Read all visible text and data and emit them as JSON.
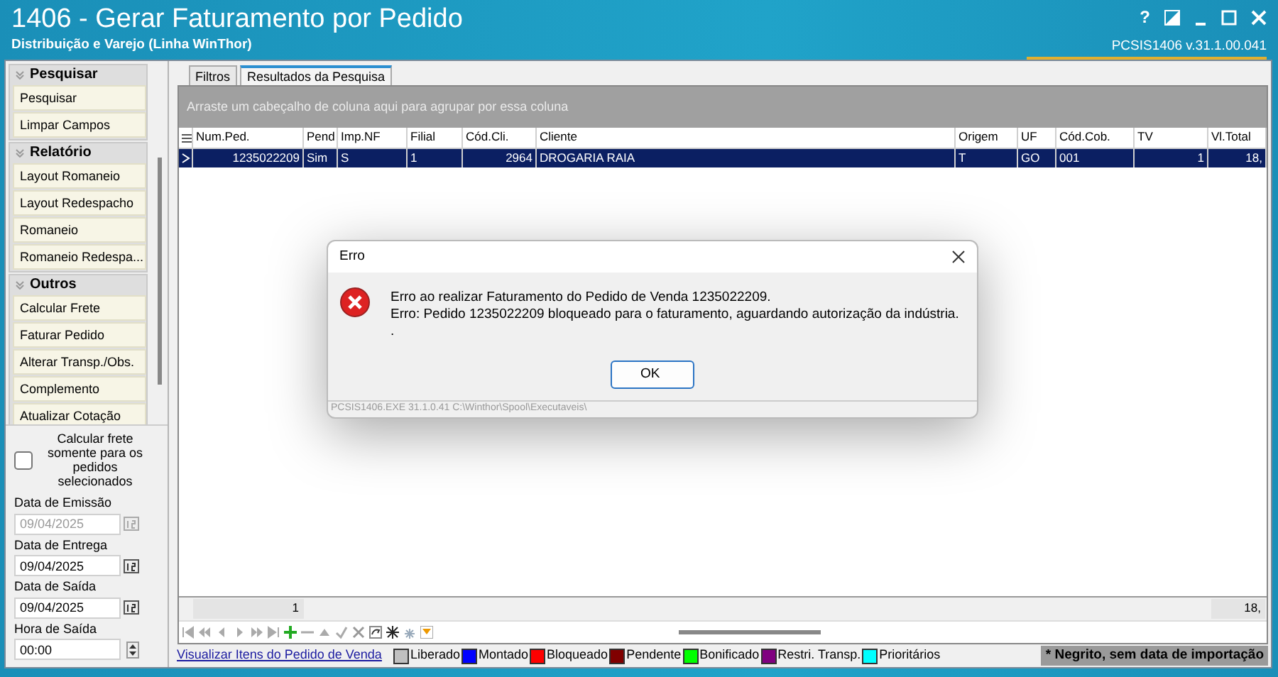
{
  "window": {
    "title": "1406 - Gerar Faturamento por Pedido",
    "subtitle": "Distribuição e Varejo (Linha WinThor)",
    "help": "?",
    "version": "PCSIS1406  v.31.1.00.041"
  },
  "sidebar": {
    "groups": [
      {
        "title": "Pesquisar",
        "items": [
          "Pesquisar",
          "Limpar Campos"
        ]
      },
      {
        "title": "Relatório",
        "items": [
          "Layout Romaneio",
          "Layout Redespacho",
          "Romaneio",
          "Romaneio Redespa..."
        ]
      },
      {
        "title": "Outros",
        "items": [
          "Calcular Frete",
          "Faturar Pedido",
          "Alterar Transp./Obs.",
          "Complemento",
          "Atualizar Cotação"
        ]
      }
    ]
  },
  "options": {
    "checkbox": {
      "label": "Calcular frete somente para os pedidos selecionados",
      "checked": false
    },
    "dates": [
      {
        "label": "Data de Emissão",
        "value": "09/04/2025",
        "disabled": true
      },
      {
        "label": "Data de Entrega",
        "value": "09/04/2025",
        "disabled": false
      },
      {
        "label": "Data de Saída",
        "value": "09/04/2025",
        "disabled": false
      }
    ],
    "time": {
      "label": "Hora de Saída",
      "value": "00:00"
    }
  },
  "tabs": [
    {
      "label": "Filtros",
      "selected": false
    },
    {
      "label": "Resultados da Pesquisa",
      "selected": true
    }
  ],
  "group_hint": "Arraste um cabeçalho de coluna aqui para agrupar por essa coluna",
  "table": {
    "columns": [
      {
        "label": "Num.Ped.",
        "numeric": true
      },
      {
        "label": "Pend",
        "numeric": false
      },
      {
        "label": "Imp.NF",
        "numeric": false
      },
      {
        "label": "Filial",
        "numeric": false
      },
      {
        "label": "Cód.Cli.",
        "numeric": true
      },
      {
        "label": "Cliente",
        "numeric": false
      },
      {
        "label": "Origem",
        "numeric": false
      },
      {
        "label": "UF",
        "numeric": false
      },
      {
        "label": "Cód.Cob.",
        "numeric": false
      },
      {
        "label": "TV",
        "numeric": true
      },
      {
        "label": "Vl.Total",
        "numeric": true
      }
    ],
    "rows": [
      {
        "selected": true,
        "cells": [
          "1235022209",
          "Sim",
          "S",
          "1",
          "2964",
          "DROGARIA RAIA",
          "T",
          "GO",
          "001",
          "1",
          "18,"
        ]
      }
    ],
    "footer": {
      "count": "1",
      "total": "18,"
    }
  },
  "link": "Visualizar Itens do Pedido de Venda",
  "legend": [
    {
      "label": "Liberado",
      "color": "#c0c0c0"
    },
    {
      "label": "Montado",
      "color": "#0000ff"
    },
    {
      "label": "Bloqueado",
      "color": "#ff0000"
    },
    {
      "label": "Pendente",
      "color": "#800000"
    },
    {
      "label": "Bonificado",
      "color": "#00ff00"
    },
    {
      "label": "Restri. Transp.",
      "color": "#800080"
    },
    {
      "label": "Prioritários",
      "color": "#00ffff"
    }
  ],
  "note": "* Negrito, sem data de importação",
  "dialog": {
    "title": "Erro",
    "lines": [
      "Erro ao realizar Faturamento do Pedido de Venda 1235022209.",
      "Erro: Pedido 1235022209 bloqueado para o faturamento, aguardando autorização da indústria.",
      "."
    ],
    "button": "OK",
    "footer": "PCSIS1406.EXE 31.1.0.41 C:\\Winthor\\Spool\\Executaveis\\"
  }
}
